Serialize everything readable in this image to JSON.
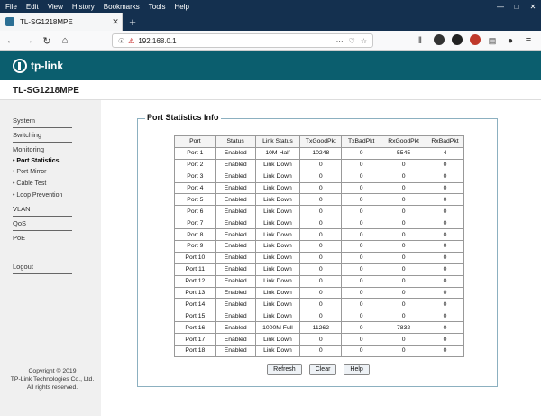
{
  "menu": [
    "File",
    "Edit",
    "View",
    "History",
    "Bookmarks",
    "Tools",
    "Help"
  ],
  "window_controls": [
    "minimize-icon",
    "maximize-icon",
    "close-icon"
  ],
  "tab": {
    "title": "TL-SG1218MPE"
  },
  "url": "192.168.0.1",
  "brand": {
    "logo_text": "tp-link",
    "model": "TL-SG1218MPE"
  },
  "colors": {
    "header": "#0b5e6e",
    "frame": "#14304f"
  },
  "sidebar": {
    "items": [
      "System",
      "Switching",
      "Monitoring"
    ],
    "monitoring_sub": [
      "Port Statistics",
      "Port Mirror",
      "Cable Test",
      "Loop Prevention"
    ],
    "items2": [
      "VLAN",
      "QoS",
      "PoE"
    ],
    "logout": "Logout",
    "copyright": [
      "Copyright © 2019",
      "TP-Link Technologies Co., Ltd.",
      "All rights reserved."
    ]
  },
  "panel": {
    "title": "Port Statistics Info"
  },
  "table": {
    "headers": [
      "Port",
      "Status",
      "Link Status",
      "TxGoodPkt",
      "TxBadPkt",
      "RxGoodPkt",
      "RxBadPkt"
    ],
    "rows": [
      [
        "Port 1",
        "Enabled",
        "10M Half",
        "10248",
        "0",
        "5545",
        "4"
      ],
      [
        "Port 2",
        "Enabled",
        "Link Down",
        "0",
        "0",
        "0",
        "0"
      ],
      [
        "Port 3",
        "Enabled",
        "Link Down",
        "0",
        "0",
        "0",
        "0"
      ],
      [
        "Port 4",
        "Enabled",
        "Link Down",
        "0",
        "0",
        "0",
        "0"
      ],
      [
        "Port 5",
        "Enabled",
        "Link Down",
        "0",
        "0",
        "0",
        "0"
      ],
      [
        "Port 6",
        "Enabled",
        "Link Down",
        "0",
        "0",
        "0",
        "0"
      ],
      [
        "Port 7",
        "Enabled",
        "Link Down",
        "0",
        "0",
        "0",
        "0"
      ],
      [
        "Port 8",
        "Enabled",
        "Link Down",
        "0",
        "0",
        "0",
        "0"
      ],
      [
        "Port 9",
        "Enabled",
        "Link Down",
        "0",
        "0",
        "0",
        "0"
      ],
      [
        "Port 10",
        "Enabled",
        "Link Down",
        "0",
        "0",
        "0",
        "0"
      ],
      [
        "Port 11",
        "Enabled",
        "Link Down",
        "0",
        "0",
        "0",
        "0"
      ],
      [
        "Port 12",
        "Enabled",
        "Link Down",
        "0",
        "0",
        "0",
        "0"
      ],
      [
        "Port 13",
        "Enabled",
        "Link Down",
        "0",
        "0",
        "0",
        "0"
      ],
      [
        "Port 14",
        "Enabled",
        "Link Down",
        "0",
        "0",
        "0",
        "0"
      ],
      [
        "Port 15",
        "Enabled",
        "Link Down",
        "0",
        "0",
        "0",
        "0"
      ],
      [
        "Port 16",
        "Enabled",
        "1000M Full",
        "11262",
        "0",
        "7832",
        "0"
      ],
      [
        "Port 17",
        "Enabled",
        "Link Down",
        "0",
        "0",
        "0",
        "0"
      ],
      [
        "Port 18",
        "Enabled",
        "Link Down",
        "0",
        "0",
        "0",
        "0"
      ]
    ]
  },
  "buttons": {
    "refresh": "Refresh",
    "clear": "Clear",
    "help": "Help"
  }
}
